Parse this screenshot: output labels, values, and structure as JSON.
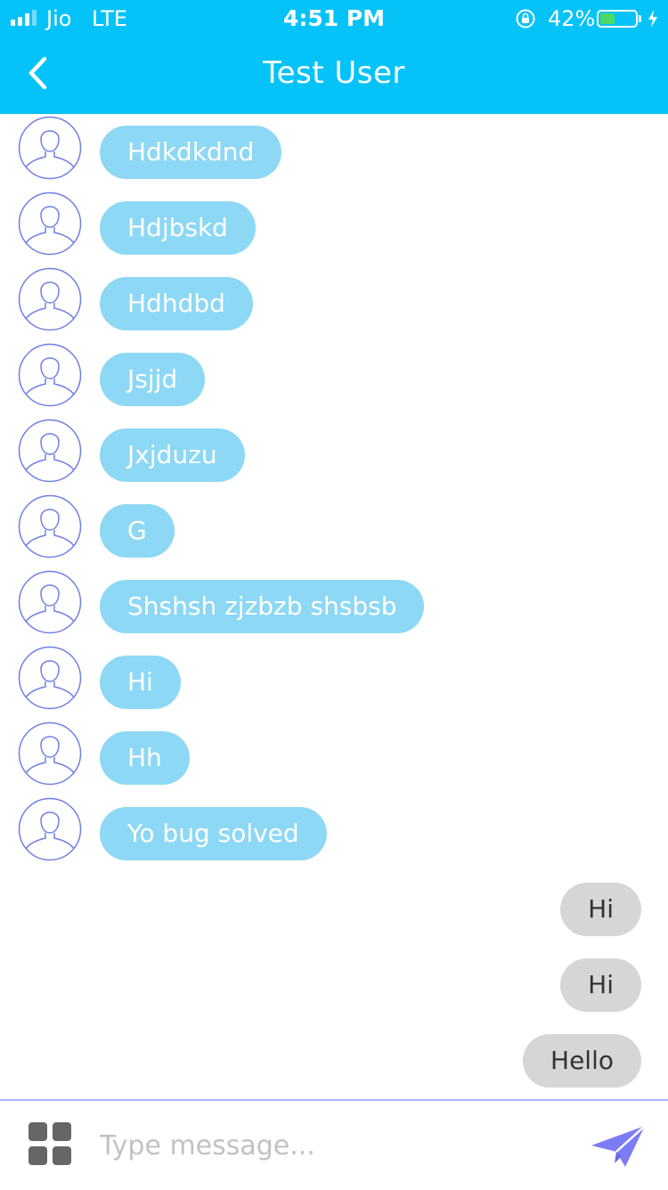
{
  "status_bar": {
    "carrier": "Jio",
    "network": "LTE",
    "time": "4:51 PM",
    "battery_percent": "42%",
    "battery_level": 0.42
  },
  "header": {
    "title": "Test User",
    "back_icon": "chevron-left-icon"
  },
  "messages": {
    "incoming": [
      "Hdkdkdnd",
      "Hdjbskd",
      "Hdhdbd",
      "Jsjjd",
      "Jxjduzu",
      "G",
      "Shshsh zjzbzb shsbsb",
      "Hi",
      "Hh",
      "Yo bug solved"
    ],
    "outgoing": [
      "Hi",
      "Hi",
      "Hello"
    ]
  },
  "composer": {
    "placeholder": "Type message...",
    "apps_icon": "grid-icon",
    "send_icon": "send-plane-icon"
  },
  "colors": {
    "header": "#05c3f9",
    "incoming_bubble": "#8dd8f4",
    "outgoing_bubble": "#d6d6d6",
    "avatar_stroke": "#6f7fe6",
    "send_icon": "#7d7cf5"
  }
}
